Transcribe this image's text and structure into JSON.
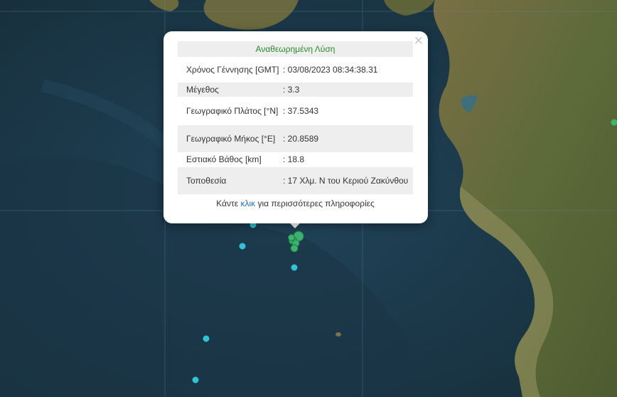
{
  "popup": {
    "title": "Αναθεωρημένη Λύση",
    "close_icon": "×",
    "rows": [
      {
        "label": "Χρόνος Γέννησης [GMT]",
        "value": ": 03/08/2023 08:34:38.31"
      },
      {
        "label": "Μέγεθος",
        "value": ": 3.3"
      },
      {
        "label": "Γεωγραφικό Πλάτος [°N]",
        "value": ": 37.5343"
      },
      {
        "label": "Γεωγραφικό Μήκος [°E]",
        "value": ": 20.8589"
      },
      {
        "label": "Εστιακό Βάθος [km]",
        "value": ": 18.8"
      },
      {
        "label": "Τοποθεσία",
        "value": ": 17 Χλμ. N του Κεριού Ζακύνθου"
      }
    ],
    "more_prefix": "Κάντε",
    "more_link": "κλικ",
    "more_suffix": "για περισσότερες πληροφορίες"
  },
  "colors": {
    "sea": "#1d3a4a",
    "land": "#6b6a3c",
    "marker_green": "#3cb46e",
    "marker_cyan": "#2ec4d6",
    "title_green": "#2a8a2a",
    "link_blue": "#1a73c7"
  }
}
